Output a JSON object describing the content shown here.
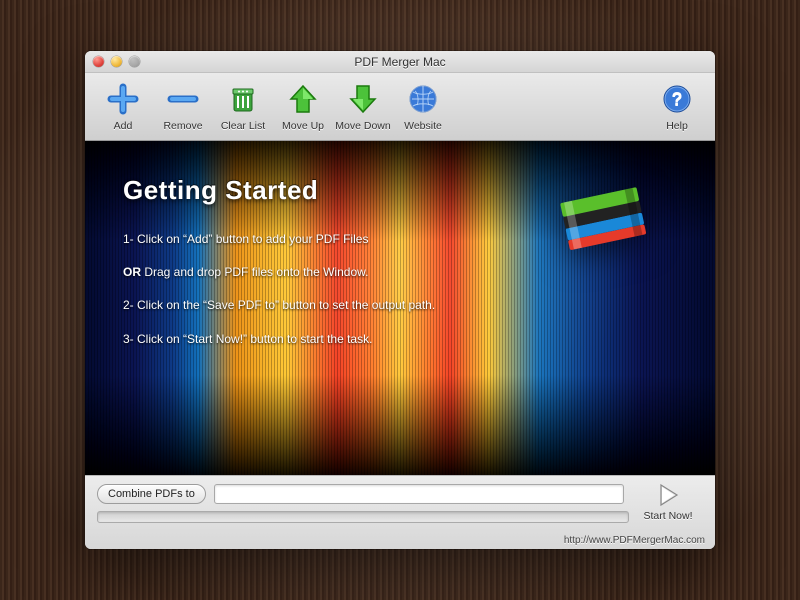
{
  "window": {
    "title": "PDF Merger Mac"
  },
  "toolbar": {
    "items": [
      {
        "label": "Add",
        "icon": "add-icon"
      },
      {
        "label": "Remove",
        "icon": "remove-icon"
      },
      {
        "label": "Clear List",
        "icon": "clear-list-icon"
      },
      {
        "label": "Move Up",
        "icon": "move-up-icon"
      },
      {
        "label": "Move Down",
        "icon": "move-down-icon"
      },
      {
        "label": "Website",
        "icon": "website-icon"
      }
    ],
    "help": {
      "label": "Help",
      "icon": "help-icon"
    }
  },
  "hero": {
    "title": "Getting Started",
    "step1": "1- Click on “Add” button to add your PDF Files",
    "or_prefix": "OR",
    "or_rest": " Drag and drop PDF files onto the Window.",
    "step2": "2- Click on the “Save PDF to” button to set the output path.",
    "step3": "3- Click on “Start Now!” button to start the task."
  },
  "bottom": {
    "combine_label": "Combine PDFs to",
    "path_value": "",
    "start_label": "Start Now!"
  },
  "footer": {
    "url": "http://www.PDFMergerMac.com"
  }
}
